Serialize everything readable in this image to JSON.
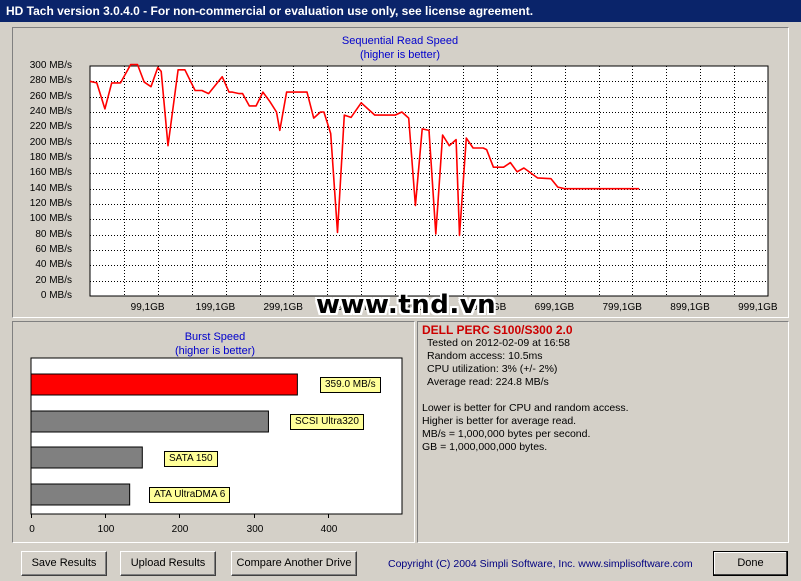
{
  "window": {
    "title": "HD Tach version 3.0.4.0  - For non-commercial or evaluation use only, see license agreement."
  },
  "watermark": "www.tnd.vn",
  "sequential_chart": {
    "title": "Sequential Read Speed",
    "subtitle": "(higher is better)",
    "y_ticks": [
      "300 MB/s",
      "280 MB/s",
      "260 MB/s",
      "240 MB/s",
      "220 MB/s",
      "200 MB/s",
      "180 MB/s",
      "160 MB/s",
      "140 MB/s",
      "120 MB/s",
      "100 MB/s",
      "80 MB/s",
      "60 MB/s",
      "40 MB/s",
      "20 MB/s",
      "0 MB/s"
    ],
    "x_ticks": [
      "99,1GB",
      "199,1GB",
      "299,1GB",
      "399,1GB",
      "499,1GB",
      "599,1GB",
      "699,1GB",
      "799,1GB",
      "899,1GB",
      "999,1GB"
    ]
  },
  "burst_chart": {
    "title": "Burst Speed",
    "subtitle": "(higher is better)",
    "x_ticks": [
      "0",
      "100",
      "200",
      "300",
      "400"
    ]
  },
  "chart_data": [
    {
      "type": "line",
      "title": "Sequential Read Speed",
      "subtitle": "(higher is better)",
      "xlabel": "",
      "ylabel": "",
      "xlim": [
        0,
        1000
      ],
      "ylim": [
        0,
        300
      ],
      "grid": true,
      "series": [
        {
          "color": "#ff0000",
          "x": [
            0,
            10,
            22,
            32,
            45,
            60,
            70,
            80,
            90,
            100,
            105,
            115,
            130,
            140,
            155,
            165,
            175,
            195,
            205,
            210,
            220,
            225,
            235,
            245,
            255,
            265,
            275,
            280,
            290,
            300,
            310,
            320,
            330,
            340,
            345,
            355,
            365,
            375,
            385,
            400,
            420,
            430,
            440,
            450,
            460,
            470,
            480,
            490,
            500,
            510,
            520,
            530,
            540,
            545,
            555,
            565,
            570,
            580,
            585,
            595,
            600,
            610,
            620,
            630,
            640,
            660,
            680,
            690,
            700,
            710,
            720,
            730,
            745,
            755,
            765,
            775,
            790,
            800,
            810
          ],
          "y": [
            280,
            278,
            244,
            278,
            278,
            302,
            302,
            279,
            273,
            298,
            293,
            196,
            295,
            295,
            268,
            268,
            264,
            286,
            266,
            266,
            264,
            264,
            248,
            248,
            266,
            254,
            240,
            216,
            266,
            266,
            266,
            266,
            232,
            240,
            240,
            212,
            83,
            236,
            233,
            252,
            236,
            236,
            236,
            236,
            240,
            232,
            118,
            218,
            216,
            81,
            210,
            196,
            204,
            79,
            206,
            193,
            193,
            193,
            191,
            168,
            168,
            168,
            174,
            162,
            167,
            154,
            153,
            142,
            140,
            140,
            140,
            140,
            140,
            140,
            140,
            140,
            140,
            140,
            140
          ]
        }
      ]
    },
    {
      "type": "bar",
      "title": "Burst Speed",
      "subtitle": "(higher is better)",
      "xlim": [
        0,
        500
      ],
      "categories": [
        "359.0 MB/s",
        "SCSI Ultra320",
        "SATA 150",
        "ATA UltraDMA 6"
      ],
      "values": [
        359.0,
        320,
        150,
        133
      ],
      "colors": [
        "#ff0000",
        "#808080",
        "#808080",
        "#808080"
      ]
    }
  ],
  "info": {
    "drive_name": "DELL PERC S100/S300 2.0",
    "tested_on": "Tested on 2012-02-09 at 16:58",
    "random_access": "Random access: 10.5ms",
    "cpu_utilization": "CPU utilization: 3% (+/- 2%)",
    "average_read": "Average read: 224.8 MB/s",
    "note_1": "Lower is better for CPU and random access.",
    "note_2": "Higher is better for average read.",
    "note_3": "MB/s = 1,000,000 bytes per second.",
    "note_4": "GB = 1,000,000,000 bytes."
  },
  "buttons": {
    "save": "Save Results",
    "upload": "Upload Results",
    "compare": "Compare Another Drive",
    "done": "Done"
  },
  "copyright": "Copyright (C) 2004 Simpli Software, Inc. www.simplisoftware.com"
}
